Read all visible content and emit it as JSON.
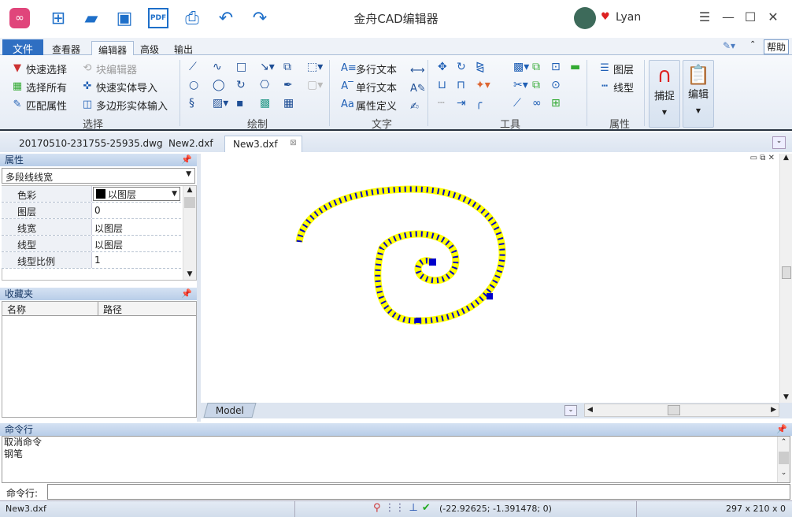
{
  "titlebar": {
    "title": "金舟CAD编辑器",
    "user": "Lyan",
    "icons": [
      "app-logo-icon",
      "new-icon",
      "open-icon",
      "save-icon",
      "pdf-icon",
      "print-icon",
      "undo-icon",
      "redo-icon"
    ]
  },
  "ribbon_tabs": [
    "文件",
    "查看器",
    "编辑器",
    "高级",
    "输出"
  ],
  "active_tab": "编辑器",
  "help": "帮助",
  "select_group": {
    "label": "选择",
    "items": [
      "快速选择",
      "选择所有",
      "匹配属性",
      "块编辑器",
      "快速实体导入",
      "多边形实体输入"
    ]
  },
  "draw_group": {
    "label": "绘制"
  },
  "text_group": {
    "label": "文字",
    "items": [
      "多行文本",
      "单行文本",
      "属性定义"
    ]
  },
  "tools_group": {
    "label": "工具"
  },
  "props_group": {
    "label": "属性",
    "items": [
      "图层",
      "线型"
    ]
  },
  "big_buttons": [
    "捕捉",
    "编辑"
  ],
  "doc_tabs": [
    "20170510-231755-25935.dwg",
    "New2.dxf",
    "New3.dxf"
  ],
  "active_doc": "New3.dxf",
  "properties": {
    "header": "属性",
    "selector": "多段线线宽",
    "rows": [
      {
        "k": "色彩",
        "v": "以图层"
      },
      {
        "k": "图层",
        "v": "0"
      },
      {
        "k": "线宽",
        "v": "以图层"
      },
      {
        "k": "线型",
        "v": "以图层"
      },
      {
        "k": "线型比例",
        "v": "1"
      }
    ]
  },
  "favorites": {
    "header": "收藏夹",
    "columns": [
      "名称",
      "路径"
    ]
  },
  "model_tab": "Model",
  "command": {
    "header": "命令行",
    "history": [
      "取消命令",
      "钢笔"
    ],
    "input_label": "命令行:",
    "input_value": ""
  },
  "status": {
    "file": "New3.dxf",
    "coords": "(-22.92625; -1.391478; 0)",
    "size": "297 x 210 x 0"
  },
  "colors": {
    "accent": "#2f6fc2",
    "spiral_fill": "#ffff00",
    "spiral_marks": "#0000cc"
  }
}
